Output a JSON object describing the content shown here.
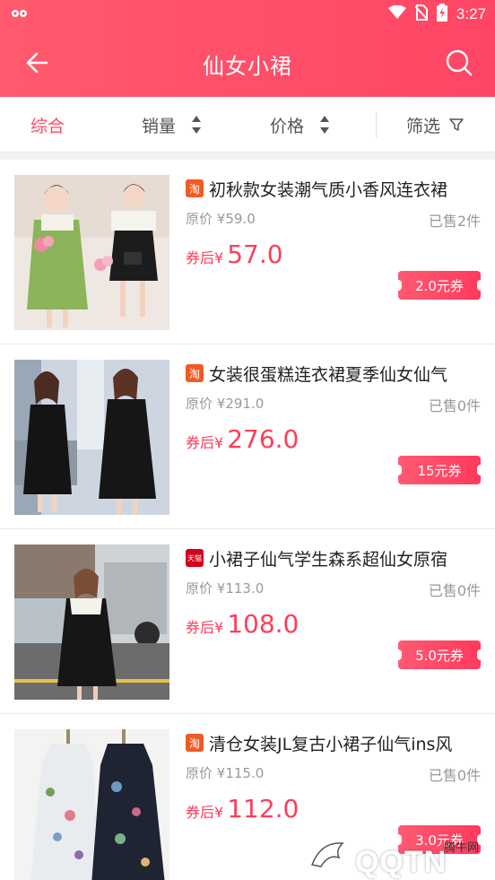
{
  "status": {
    "time": "3:27"
  },
  "header": {
    "title": "仙女小裙"
  },
  "sort": {
    "overall": "综合",
    "sales": "销量",
    "price": "价格",
    "filter": "筛选"
  },
  "products": [
    {
      "shop": "淘",
      "name": "初秋款女装潮气质小香风连衣裙",
      "original_label": "原价",
      "original_price": "¥59.0",
      "sold": "已售2件",
      "after_label": "券后",
      "after_currency": "¥",
      "after_price": "57.0",
      "coupon": "2.0元券"
    },
    {
      "shop": "淘",
      "name": "女装很蛋糕连衣裙夏季仙女仙气",
      "original_label": "原价",
      "original_price": "¥291.0",
      "sold": "已售0件",
      "after_label": "券后",
      "after_currency": "¥",
      "after_price": "276.0",
      "coupon": "15元券"
    },
    {
      "shop": "天猫",
      "name": "小裙子仙气学生森系超仙女原宿",
      "original_label": "原价",
      "original_price": "¥113.0",
      "sold": "已售0件",
      "after_label": "券后",
      "after_currency": "¥",
      "after_price": "108.0",
      "coupon": "5.0元券"
    },
    {
      "shop": "淘",
      "name": "清仓女装JL复古小裙子仙气ins风",
      "original_label": "原价",
      "original_price": "¥115.0",
      "sold": "已售0件",
      "after_label": "券后",
      "after_currency": "¥",
      "after_price": "112.0",
      "coupon": "3.0元券"
    }
  ],
  "watermark": {
    "main": "QQTN",
    "small": "腾牛网"
  },
  "colors": {
    "accent": "#ff4a64",
    "header": "#ff5069"
  }
}
